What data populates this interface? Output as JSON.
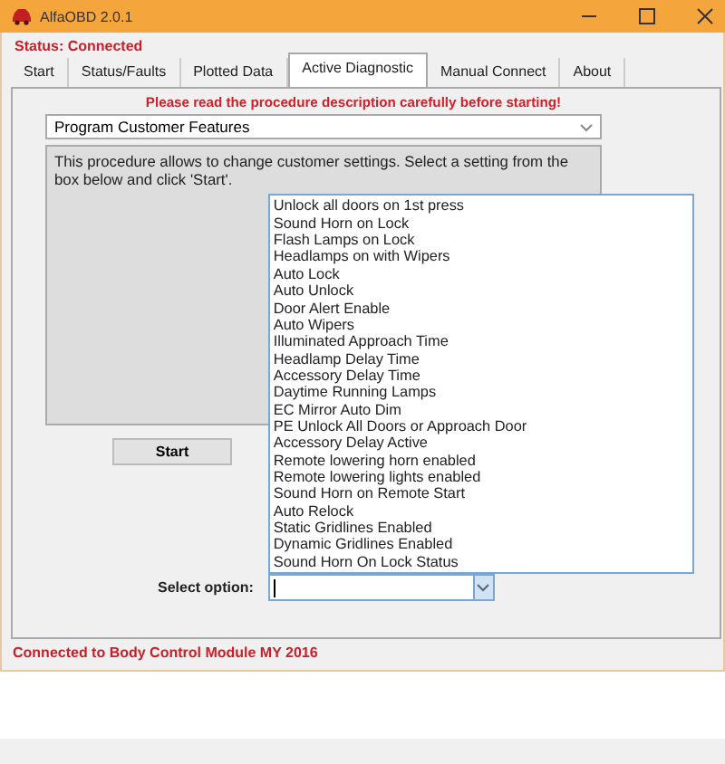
{
  "window": {
    "title": "AlfaOBD 2.0.1"
  },
  "status": "Status: Connected",
  "tabs": [
    {
      "label": "Start",
      "selected": false
    },
    {
      "label": "Status/Faults",
      "selected": false
    },
    {
      "label": "Plotted Data",
      "selected": false
    },
    {
      "label": "Active Diagnostic",
      "selected": true
    },
    {
      "label": "Manual Connect",
      "selected": false
    },
    {
      "label": "About",
      "selected": false
    }
  ],
  "warning": "Please read the procedure description carefully before starting!",
  "procedure": {
    "value": "Program Customer Features"
  },
  "description": "This procedure allows to change customer settings. Select a setting from the box below and click 'Start'.",
  "start_button": "Start",
  "select_option": {
    "label": "Select option:",
    "expanded": true,
    "options": [
      "Unlock all doors on 1st press",
      "Sound Horn on Lock",
      "Flash Lamps on Lock",
      "Headlamps on with Wipers",
      "Auto Lock",
      "Auto Unlock",
      "Door Alert Enable",
      "Auto Wipers",
      "Illuminated Approach Time",
      "Headlamp Delay Time",
      "Accessory Delay Time",
      "Daytime Running Lamps",
      "EC Mirror Auto Dim",
      "PE Unlock All Doors or Approach Door",
      "Accessory Delay Active",
      "Remote lowering horn enabled",
      "Remote lowering lights enabled",
      "Sound Horn on Remote Start",
      "Auto Relock",
      "Static Gridlines Enabled",
      "Dynamic Gridlines Enabled",
      "Sound Horn On Lock Status"
    ]
  },
  "status_bar": "Connected to Body Control Module MY 2016"
}
